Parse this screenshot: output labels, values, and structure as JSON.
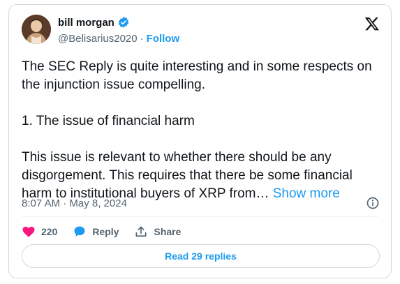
{
  "author": {
    "display_name": "bill morgan",
    "handle": "@Belisarius2020",
    "separator": "·",
    "follow_label": "Follow",
    "verified_icon": "verified-badge-icon"
  },
  "tweet": {
    "text": "The SEC Reply is quite interesting and in some respects on the injunction issue compelling.\n\n1. The issue of financial harm\n\nThis issue is relevant to whether there should be any disgorgement. This requires that there be some financial harm to institutional buyers of XRP from… ",
    "show_more_label": "Show more",
    "timestamp": "8:07 AM · May 8, 2024"
  },
  "actions": {
    "like_count": "220",
    "reply_label": "Reply",
    "share_label": "Share"
  },
  "read_replies_label": "Read 29 replies",
  "colors": {
    "accent": "#1d9bf0",
    "like": "#f91880",
    "muted": "#536471",
    "text": "#0f1419",
    "border": "#cfd9de"
  }
}
